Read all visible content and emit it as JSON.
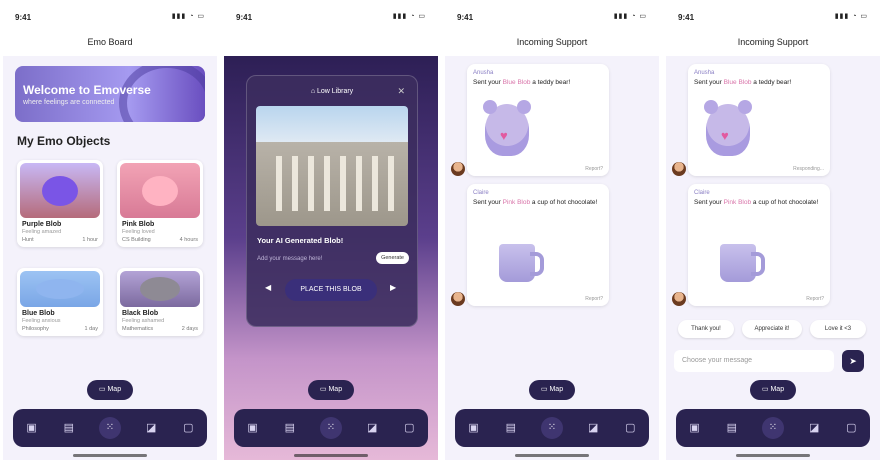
{
  "colors": {
    "accent": "#2a2350",
    "highlight": "#d874a9",
    "bg": "#f4f2fb"
  },
  "status_time": "9:41",
  "nav_icons": [
    "inbox-icon",
    "box-icon",
    "grid-icon",
    "chat-icon",
    "profile-icon"
  ],
  "map_label": "Map",
  "screen1": {
    "header": "Emo Board",
    "banner_title": "Welcome to Emoverse",
    "banner_sub": "where feelings are connected",
    "section_title": "My Emo Objects",
    "cards": [
      {
        "name": "Purple Blob",
        "desc": "Feeling amazed",
        "place": "Hunt",
        "count": "1 hour"
      },
      {
        "name": "Pink Blob",
        "desc": "Feeling loved",
        "place": "CS Building",
        "count": "4 hours"
      },
      {
        "name": "Blue Blob",
        "desc": "Feeling anxious",
        "place": "Philosophy",
        "count": "1 day"
      },
      {
        "name": "Black Blob",
        "desc": "Feeling ashamed",
        "place": "Mathematics",
        "count": "2 days"
      }
    ]
  },
  "screen2": {
    "modal_title": "Low Library",
    "caption": "Your AI Generated Blob!",
    "message_placeholder": "Add your message here!",
    "generate_label": "Generate",
    "place_label": "PLACE THIS BLOB"
  },
  "screen3": {
    "header": "Incoming Support",
    "messages": [
      {
        "sender": "Anusha",
        "pre": "Sent your ",
        "hl": "Blue Blob",
        "post": " a teddy bear!",
        "status": "Report?"
      },
      {
        "sender": "Claire",
        "pre": "Sent your ",
        "hl": "Pink Blob",
        "post": " a cup of hot chocolate!",
        "status": "Report?"
      }
    ]
  },
  "screen4": {
    "header": "Incoming Support",
    "messages": [
      {
        "sender": "Anusha",
        "pre": "Sent your ",
        "hl": "Blue Blob",
        "post": " a teddy bear!",
        "status": "Responding..."
      },
      {
        "sender": "Claire",
        "pre": "Sent your ",
        "hl": "Pink Blob",
        "post": " a cup of hot chocolate!",
        "status": "Report?"
      }
    ],
    "quick_replies": [
      "Thank you!",
      "Appreciate it!",
      "Love it <3"
    ],
    "input_placeholder": "Choose your message"
  }
}
